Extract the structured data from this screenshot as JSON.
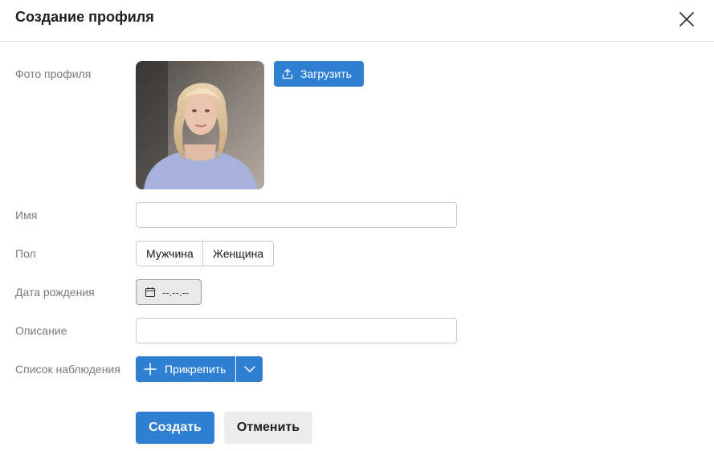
{
  "dialog": {
    "title": "Создание профиля"
  },
  "fields": {
    "photo_label": "Фото профиля",
    "name_label": "Имя",
    "gender_label": "Пол",
    "birthdate_label": "Дата рождения",
    "description_label": "Описание",
    "watchlist_label": "Список наблюдения"
  },
  "photo": {
    "upload_label": "Загрузить"
  },
  "name": {
    "value": "",
    "placeholder": ""
  },
  "gender": {
    "options": [
      "Мужчина",
      "Женщина"
    ]
  },
  "birthdate": {
    "value": "--.--.--"
  },
  "description": {
    "value": "",
    "placeholder": ""
  },
  "watchlist": {
    "attach_label": "Прикрепить"
  },
  "actions": {
    "create_label": "Создать",
    "cancel_label": "Отменить"
  },
  "icons": {
    "close": "close-icon",
    "upload": "upload-icon",
    "calendar": "calendar-icon",
    "plus": "plus-icon",
    "chevron": "chevron-down-icon"
  },
  "colors": {
    "primary": "#2f7fd3",
    "cancel_bg": "#ececec",
    "border": "#c9c9c9"
  }
}
